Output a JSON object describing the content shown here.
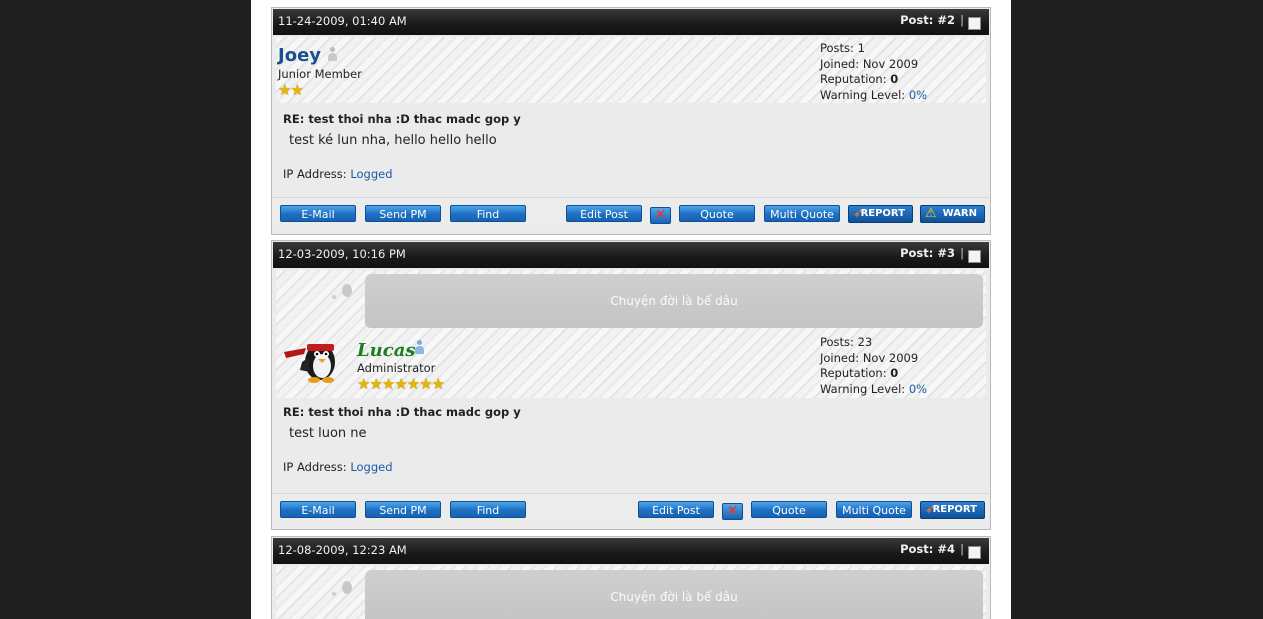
{
  "posts": [
    {
      "date": "11-24-2009, 01:40 AM",
      "post_label": "Post: #2",
      "sep": "|",
      "username": "Joey",
      "user_title": "Junior Member",
      "stars": "★★",
      "stats": {
        "posts": "Posts: 1",
        "joined": "Joined: Nov 2009",
        "reputation_label": "Reputation: ",
        "reputation": "0",
        "warning_label": "Warning Level: ",
        "warning": "0%"
      },
      "title": "RE: test thoi nha :D thac madc gop y",
      "body": "test ké lun nha, hello hello hello",
      "ip_label": "IP Address: ",
      "ip_value": "Logged",
      "buttons": {
        "email": "E-Mail",
        "pm": "Send PM",
        "find": "Find",
        "edit": "Edit Post",
        "delete": "✕",
        "quote": "Quote",
        "multiquote": "Multi Quote",
        "report": "REPORT",
        "warn": "WARN"
      }
    },
    {
      "date": "12-03-2009, 10:16 PM",
      "post_label": "Post: #3",
      "sep": "|",
      "signature": "Chuyện đời là bể dâu",
      "username": "Lucas",
      "user_title": "Administrator",
      "stars": "★★★★★★★",
      "stats": {
        "posts": "Posts: 23",
        "joined": "Joined: Nov 2009",
        "reputation_label": "Reputation: ",
        "reputation": "0",
        "warning_label": "Warning Level: ",
        "warning": "0%"
      },
      "title": "RE: test thoi nha :D thac madc gop y",
      "body": "test luon ne",
      "ip_label": "IP Address: ",
      "ip_value": "Logged",
      "buttons": {
        "email": "E-Mail",
        "pm": "Send PM",
        "find": "Find",
        "edit": "Edit Post",
        "delete": "✕",
        "quote": "Quote",
        "multiquote": "Multi Quote",
        "report": "REPORT"
      }
    },
    {
      "date": "12-08-2009, 12:23 AM",
      "post_label": "Post: #4",
      "sep": "|",
      "signature": "Chuyện đời là bể dâu"
    }
  ],
  "icons": {
    "online_status": "user-offline-icon",
    "report": "rocket-icon",
    "warn": "warning-triangle-icon",
    "avatar": "penguin-ninja-avatar"
  },
  "colors": {
    "header_bg": "#1b1b1b",
    "button_blue": "#1d6fc2",
    "link": "#1a5aa6",
    "admin_name": "#1e7d1e",
    "member_name": "#1a4f8f"
  }
}
